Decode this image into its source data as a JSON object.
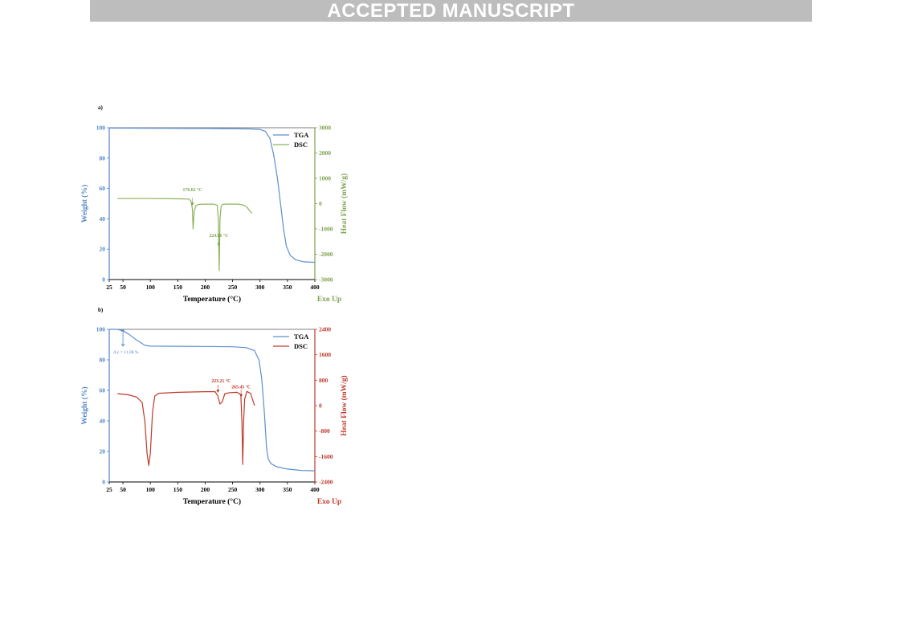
{
  "header": {
    "banner": "ACCEPTED MANUSCRIPT"
  },
  "chart_data": [
    {
      "panel_label": "a)",
      "type": "line",
      "xlabel": "Temperature (°C)",
      "ylabel": "Weight (%)",
      "y2label": "Heat Flow (mW/g)",
      "exo_label": "Exo Up",
      "xlim": [
        25,
        400
      ],
      "xticks": [
        25,
        50,
        100,
        150,
        200,
        250,
        300,
        350,
        400
      ],
      "ylim": [
        0,
        100
      ],
      "yticks": [
        0,
        20,
        40,
        60,
        80,
        100
      ],
      "y2lim": [
        -3000,
        3000
      ],
      "y2ticks": [
        -3000,
        -2000,
        -1000,
        0,
        1000,
        2000,
        3000
      ],
      "colors": {
        "left_axis": "#4f86c6",
        "right_axis": "#7ea04d",
        "tga": "#5b8fd0",
        "dsc": "#8eb35a"
      },
      "legend": {
        "position": "top-right",
        "entries": [
          "TGA",
          "DSC"
        ]
      },
      "series": [
        {
          "name": "TGA",
          "axis": "left",
          "x": [
            25,
            100,
            200,
            280,
            300,
            310,
            318,
            325,
            332,
            338,
            343,
            348,
            355,
            365,
            380,
            400
          ],
          "y": [
            99.8,
            99.7,
            99.5,
            99.2,
            98.9,
            97.5,
            93,
            82,
            66,
            48,
            33,
            22,
            16,
            13,
            11.7,
            11.3
          ]
        },
        {
          "name": "DSC",
          "axis": "right",
          "x": [
            40,
            100,
            150,
            170,
            174,
            176.6,
            178,
            180,
            183,
            188,
            200,
            215,
            222,
            224,
            225.5,
            227,
            229,
            232,
            240,
            260,
            270,
            276,
            280,
            285
          ],
          "y": [
            200,
            200,
            190,
            180,
            100,
            -200,
            -1000,
            -300,
            -80,
            -30,
            -20,
            -20,
            -60,
            -700,
            -2650,
            -600,
            -100,
            -30,
            -20,
            -20,
            -60,
            -130,
            -250,
            -380
          ]
        }
      ],
      "annotations": [
        {
          "text": "176.62 °C",
          "x": 176.62
        },
        {
          "text": "224.86 °C",
          "x": 224.86
        }
      ]
    },
    {
      "panel_label": "b)",
      "type": "line",
      "xlabel": "Temperature (°C)",
      "ylabel": "Weight (%)",
      "y2label": "Heat Flow (mW/g)",
      "exo_label": "Exo Up",
      "xlim": [
        25,
        400
      ],
      "xticks": [
        25,
        50,
        100,
        150,
        200,
        250,
        300,
        350,
        400
      ],
      "ylim": [
        0,
        100
      ],
      "yticks": [
        0,
        20,
        40,
        60,
        80,
        100
      ],
      "y2lim": [
        -2400,
        2400
      ],
      "y2ticks": [
        -2400,
        -1600,
        -800,
        0,
        800,
        1600,
        2400
      ],
      "colors": {
        "left_axis": "#4f86c6",
        "right_axis": "#c0392b",
        "tga": "#5b8fd0",
        "dsc": "#c0392b"
      },
      "legend": {
        "position": "top-right",
        "entries": [
          "TGA",
          "DSC"
        ]
      },
      "series": [
        {
          "name": "TGA",
          "axis": "left",
          "x": [
            25,
            40,
            50,
            60,
            75,
            90,
            100,
            150,
            200,
            250,
            275,
            290,
            298,
            303,
            308,
            312,
            315,
            320,
            330,
            350,
            375,
            400
          ],
          "y": [
            100,
            100,
            99,
            97,
            93,
            89.5,
            89,
            88.9,
            88.8,
            88.6,
            88,
            86,
            80,
            68,
            45,
            22,
            15,
            12,
            10,
            8.5,
            7.6,
            7.3
          ]
        },
        {
          "name": "DSC",
          "axis": "right",
          "x": [
            40,
            60,
            75,
            85,
            90,
            94,
            97,
            100,
            104,
            108,
            115,
            150,
            200,
            218,
            223.21,
            227,
            231,
            236,
            245,
            258,
            265,
            267,
            268.5,
            270,
            272,
            276,
            283,
            290
          ],
          "y": [
            380,
            340,
            270,
            100,
            -500,
            -1500,
            -1880,
            -1500,
            -200,
            300,
            390,
            420,
            440,
            440,
            300,
            50,
            120,
            380,
            410,
            420,
            350,
            -500,
            -1850,
            -500,
            200,
            450,
            380,
            0
          ]
        }
      ],
      "annotations": [
        {
          "text": "Δ y = 11.08 %",
          "x": 50
        },
        {
          "text": "223.21 °C",
          "x": 223.21
        },
        {
          "text": "265.45 °C",
          "x": 265.45
        }
      ]
    }
  ]
}
